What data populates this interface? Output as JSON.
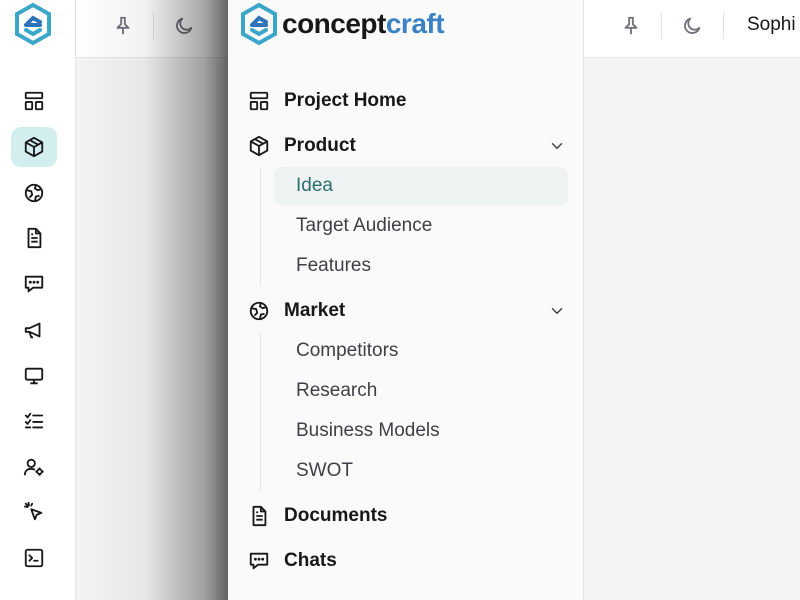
{
  "app": {
    "brand_part1": "concept",
    "brand_part2": "craft"
  },
  "colors": {
    "accent": "#3b82c4",
    "active_bg": "#d3eeee",
    "active_sub_bg": "#eef2f2"
  },
  "rail": {
    "icons": [
      "layout-icon",
      "cube-icon",
      "globe-icon",
      "document-icon",
      "chat-icon",
      "megaphone-icon",
      "monitor-icon",
      "checklist-icon",
      "user-settings-icon",
      "cursor-click-icon",
      "terminal-icon"
    ],
    "active": "cube-icon"
  },
  "topbar": {
    "user_name": "Sophi"
  },
  "nav": {
    "project_home": "Project Home",
    "product": {
      "label": "Product",
      "items": [
        "Idea",
        "Target Audience",
        "Features"
      ],
      "active": "Idea"
    },
    "market": {
      "label": "Market",
      "items": [
        "Competitors",
        "Research",
        "Business Models",
        "SWOT"
      ]
    },
    "documents": "Documents",
    "chats": "Chats"
  }
}
